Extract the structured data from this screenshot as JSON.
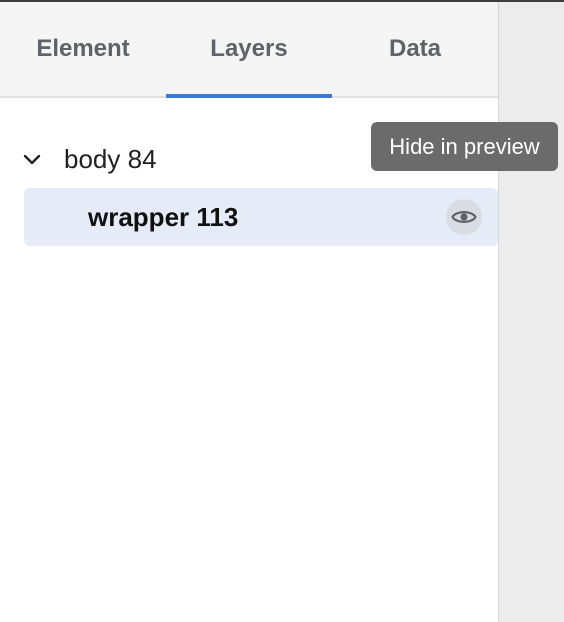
{
  "tabs": [
    {
      "label": "Element",
      "active": false
    },
    {
      "label": "Layers",
      "active": true
    },
    {
      "label": "Data",
      "active": false
    }
  ],
  "layers": {
    "body": {
      "label": "body 84",
      "expanded": true,
      "icon": "chevron-down-icon"
    },
    "wrapper": {
      "label": "wrapper 113",
      "selected": true,
      "icon": "eye-icon"
    }
  },
  "tooltip": {
    "text": "Hide in preview"
  },
  "colors": {
    "accent": "#3b78d8",
    "selected_row": "#e5ecf8",
    "tooltip_bg": "#6b6b6b",
    "tab_bar_bg": "#f5f5f5",
    "side_area_bg": "#ececec"
  }
}
